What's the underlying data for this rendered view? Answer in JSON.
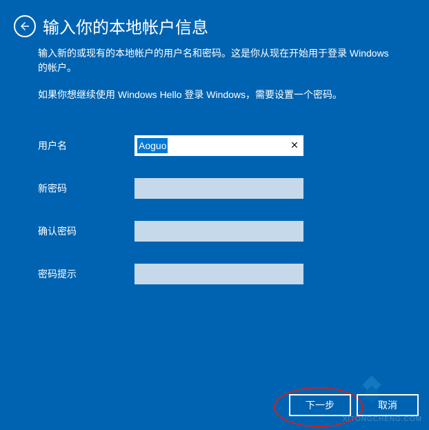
{
  "header": {
    "title": "输入你的本地帐户信息"
  },
  "description": {
    "line1": "输入新的或现有的本地帐户的用户名和密码。这是你从现在开始用于登录 Windows 的帐户。",
    "line2": "如果你想继续使用 Windows Hello 登录 Windows，需要设置一个密码。"
  },
  "form": {
    "username": {
      "label": "用户名",
      "value": "Aoguo"
    },
    "newPassword": {
      "label": "新密码",
      "value": ""
    },
    "confirmPassword": {
      "label": "确认密码",
      "value": ""
    },
    "passwordHint": {
      "label": "密码提示",
      "value": ""
    }
  },
  "buttons": {
    "next": "下一步",
    "cancel": "取消"
  },
  "watermark": "XITONGCHENG.COM"
}
